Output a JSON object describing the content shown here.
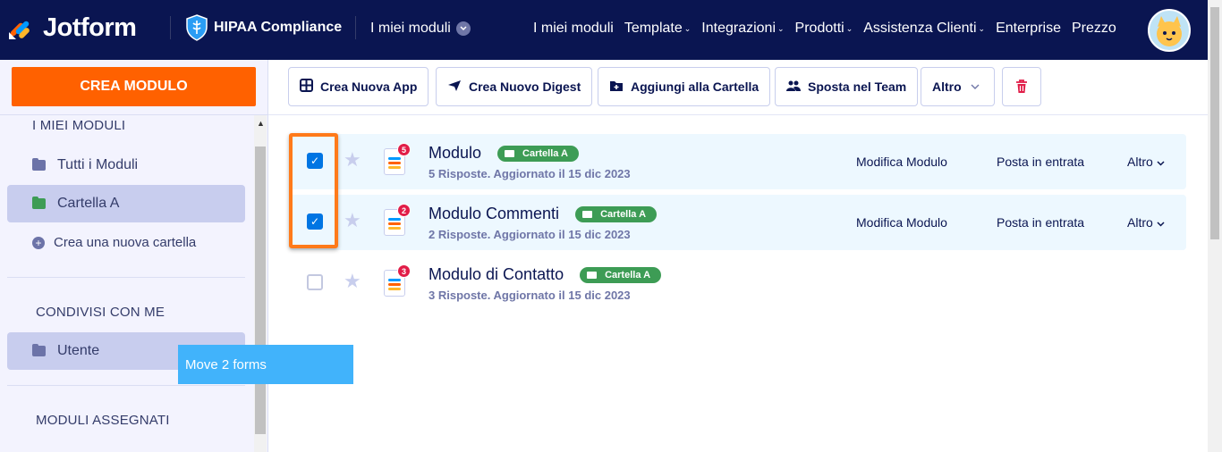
{
  "header": {
    "logo_text": "Jotform",
    "hipaa_label": "HIPAA Compliance",
    "my_forms_dropdown": "I miei moduli",
    "nav": [
      "I miei moduli",
      "Template",
      "Integrazioni",
      "Prodotti",
      "Assistenza Clienti",
      "Enterprise",
      "Prezzo"
    ],
    "nav_caret": "⌄"
  },
  "sidebar": {
    "create_button": "CREA MODULO",
    "my_forms_title": "I MIEI MODULI",
    "items": [
      {
        "label": "Tutti i Moduli",
        "color": "#6c73a8"
      },
      {
        "label": "Cartella A",
        "color": "#3d9c55"
      }
    ],
    "new_folder": "Crea una nuova cartella",
    "shared_title": "CONDIVISI CON ME",
    "shared_items": [
      {
        "label": "Utente",
        "color": "#6c73a8"
      }
    ],
    "assigned_title": "MODULI ASSEGNATI"
  },
  "drag_tooltip": "Move 2 forms",
  "toolbar": {
    "create_app": "Crea Nuova App",
    "create_digest": "Crea Nuovo Digest",
    "add_folder": "Aggiungi alla Cartella",
    "move_team": "Sposta nel Team",
    "more": "Altro"
  },
  "forms": [
    {
      "name": "Modulo",
      "folder": "Cartella A",
      "meta": "5 Risposte. Aggiornato il 15 dic 2023",
      "badge": "5",
      "selected": true,
      "edit": "Modifica Modulo",
      "inbox": "Posta in entrata",
      "more": "Altro"
    },
    {
      "name": "Modulo Commenti",
      "folder": "Cartella A",
      "meta": "2 Risposte. Aggiornato il 15 dic 2023",
      "badge": "2",
      "selected": true,
      "edit": "Modifica Modulo",
      "inbox": "Posta in entrata",
      "more": "Altro"
    },
    {
      "name": "Modulo di Contatto",
      "folder": "Cartella A",
      "meta": "3 Risposte. Aggiornato il 15 dic 2023",
      "badge": "3",
      "selected": false
    }
  ],
  "colors": {
    "nav_bg": "#0a1551",
    "accent": "#ff6100",
    "folder_tag": "#3d9c55",
    "checkbox": "#0075e3",
    "tooltip": "#41b3fb"
  }
}
